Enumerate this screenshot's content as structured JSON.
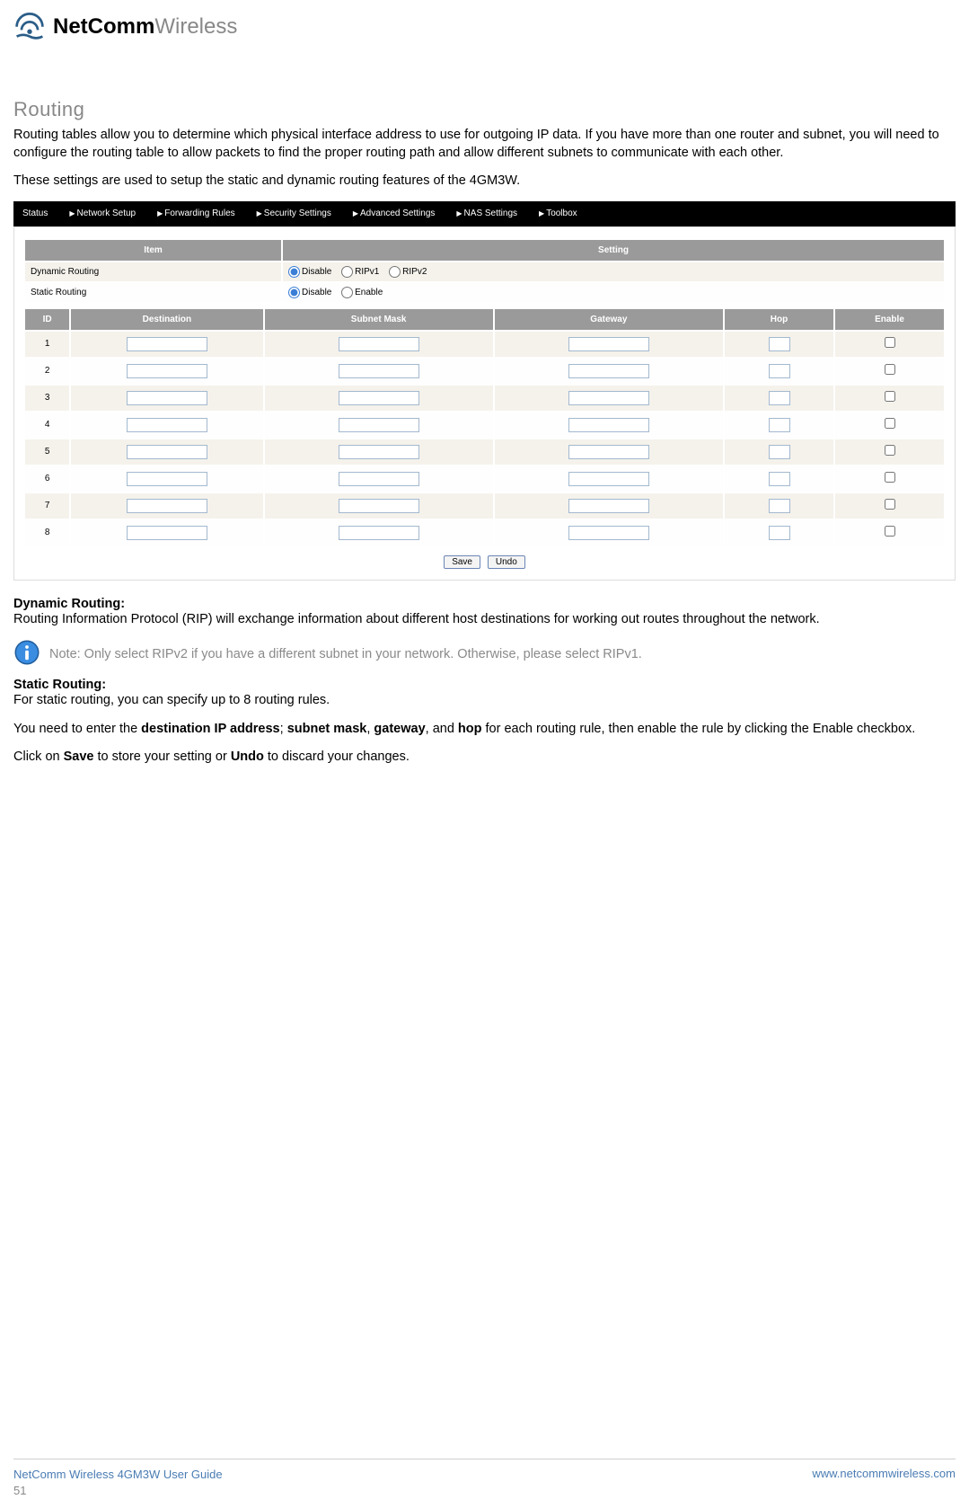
{
  "brand": {
    "bold": "NetComm",
    "light": "Wireless"
  },
  "heading": "Routing",
  "intro1": "Routing tables allow you to determine which physical interface address to use for outgoing IP data. If you have more than one router and subnet, you will need to configure the routing table to allow packets to find the proper routing path and allow different subnets to communicate with each other.",
  "intro2": "These settings are used to setup the static and dynamic routing features of the 4GM3W.",
  "nav": [
    "Status",
    "Network Setup",
    "Forwarding Rules",
    "Security Settings",
    "Advanced Settings",
    "NAS Settings",
    "Toolbox"
  ],
  "settings": {
    "th_item": "Item",
    "th_setting": "Setting",
    "dynamic_label": "Dynamic Routing",
    "dynamic_options": [
      "Disable",
      "RIPv1",
      "RIPv2"
    ],
    "static_label": "Static Routing",
    "static_options": [
      "Disable",
      "Enable"
    ]
  },
  "routing": {
    "th_id": "ID",
    "th_dest": "Destination",
    "th_mask": "Subnet Mask",
    "th_gw": "Gateway",
    "th_hop": "Hop",
    "th_enable": "Enable",
    "rows": [
      "1",
      "2",
      "3",
      "4",
      "5",
      "6",
      "7",
      "8"
    ]
  },
  "buttons": {
    "save": "Save",
    "undo": "Undo"
  },
  "sections": {
    "dyn_head": "Dynamic Routing:",
    "dyn_body": "Routing Information Protocol (RIP) will exchange information about different host destinations for working out routes throughout the network.",
    "note": "Note: Only select RIPv2 if you have a different subnet in your network. Otherwise, please select RIPv1.",
    "stat_head": "Static Routing:",
    "stat_body": "For static routing, you can specify up to 8 routing rules.",
    "need_prefix": "You need to enter the ",
    "need_b1": "destination IP address",
    "need_sep1": "; ",
    "need_b2": "subnet mask",
    "need_sep2": ", ",
    "need_b3": "gateway",
    "need_sep3": ", and ",
    "need_b4": "hop",
    "need_suffix": " for each routing rule, then enable the rule by clicking the Enable checkbox.",
    "final_prefix": "Click on ",
    "final_b1": "Save",
    "final_mid": " to store your setting or ",
    "final_b2": "Undo",
    "final_suffix": " to discard your changes."
  },
  "footer": {
    "guide": "NetComm Wireless 4GM3W User Guide",
    "page": "51",
    "url": "www.netcommwireless.com"
  }
}
